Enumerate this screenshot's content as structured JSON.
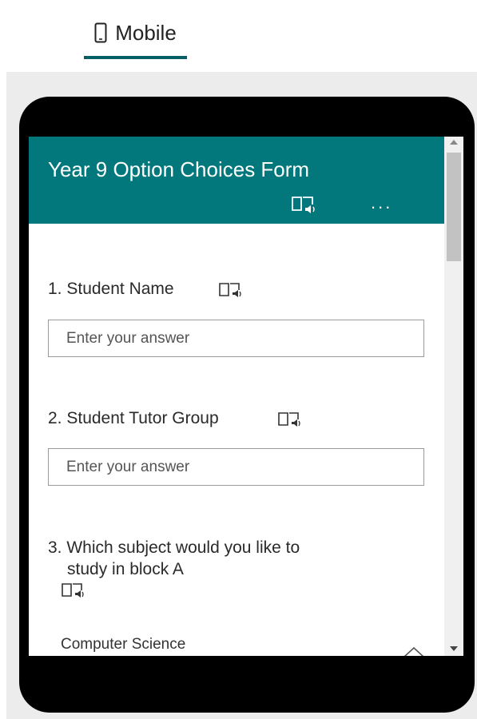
{
  "mode_tab": {
    "label": "Mobile",
    "icon": "phone-icon"
  },
  "form": {
    "title": "Year 9 Option Choices Form",
    "more_label": "...",
    "header_color": "#03787c"
  },
  "questions": [
    {
      "number": "1.",
      "title": "Student Name",
      "placeholder": "Enter your answer"
    },
    {
      "number": "2.",
      "title": "Student Tutor Group",
      "placeholder": "Enter your answer"
    },
    {
      "number": "3.",
      "title_line1": "Which subject would you like to",
      "title_line2": "study in block A",
      "selected": "Computer Science"
    }
  ]
}
